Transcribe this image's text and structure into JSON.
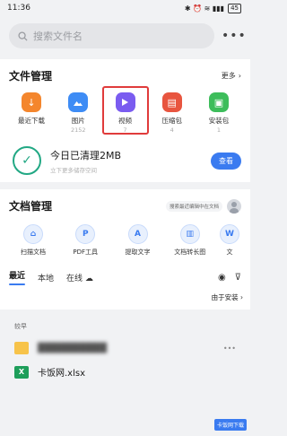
{
  "status_bar": {
    "time": "11:36",
    "icons": "✱ ⏰ ≋ ▮▮▮",
    "battery": "45"
  },
  "search": {
    "placeholder": "搜索文件名",
    "more": "•••"
  },
  "file_management": {
    "title": "文件管理",
    "more_label": "更多",
    "categories": [
      {
        "label": "最近下载",
        "count": "",
        "color": "#f4862d",
        "icon": "download-icon"
      },
      {
        "label": "图片",
        "count": "2152",
        "color": "#3e8cf5",
        "icon": "image-icon"
      },
      {
        "label": "视频",
        "count": "7",
        "color": "#7a5cf0",
        "icon": "video-icon"
      },
      {
        "label": "压缩包",
        "count": "4",
        "color": "#e8553f",
        "icon": "archive-icon"
      },
      {
        "label": "安装包",
        "count": "1",
        "color": "#3dbd5b",
        "icon": "package-icon"
      }
    ],
    "clean": {
      "title": "今日已清理2MB",
      "subtitle": "立下更多储存空间",
      "button": "查看"
    }
  },
  "doc_management": {
    "title": "文档管理",
    "hint": "搜索最近编辑中在文档",
    "tools": [
      {
        "label": "扫描文档",
        "icon": "scan-icon"
      },
      {
        "label": "PDF工具",
        "icon": "pdf-icon"
      },
      {
        "label": "提取文字",
        "icon": "text-extract-icon"
      },
      {
        "label": "文档转长图",
        "icon": "long-image-icon"
      },
      {
        "label": "文",
        "icon": "doc-icon"
      }
    ],
    "tabs": [
      {
        "label": "最近",
        "active": true
      },
      {
        "label": "本地",
        "active": false
      },
      {
        "label": "在线",
        "active": false
      }
    ],
    "sort_label": "由于安装"
  },
  "file_list": {
    "group": "较早",
    "items": [
      {
        "name": "██████████",
        "type": "folder"
      },
      {
        "name": "卡饭网.xlsx",
        "type": "xlsx"
      }
    ]
  },
  "watermark": "卡饭网下载"
}
